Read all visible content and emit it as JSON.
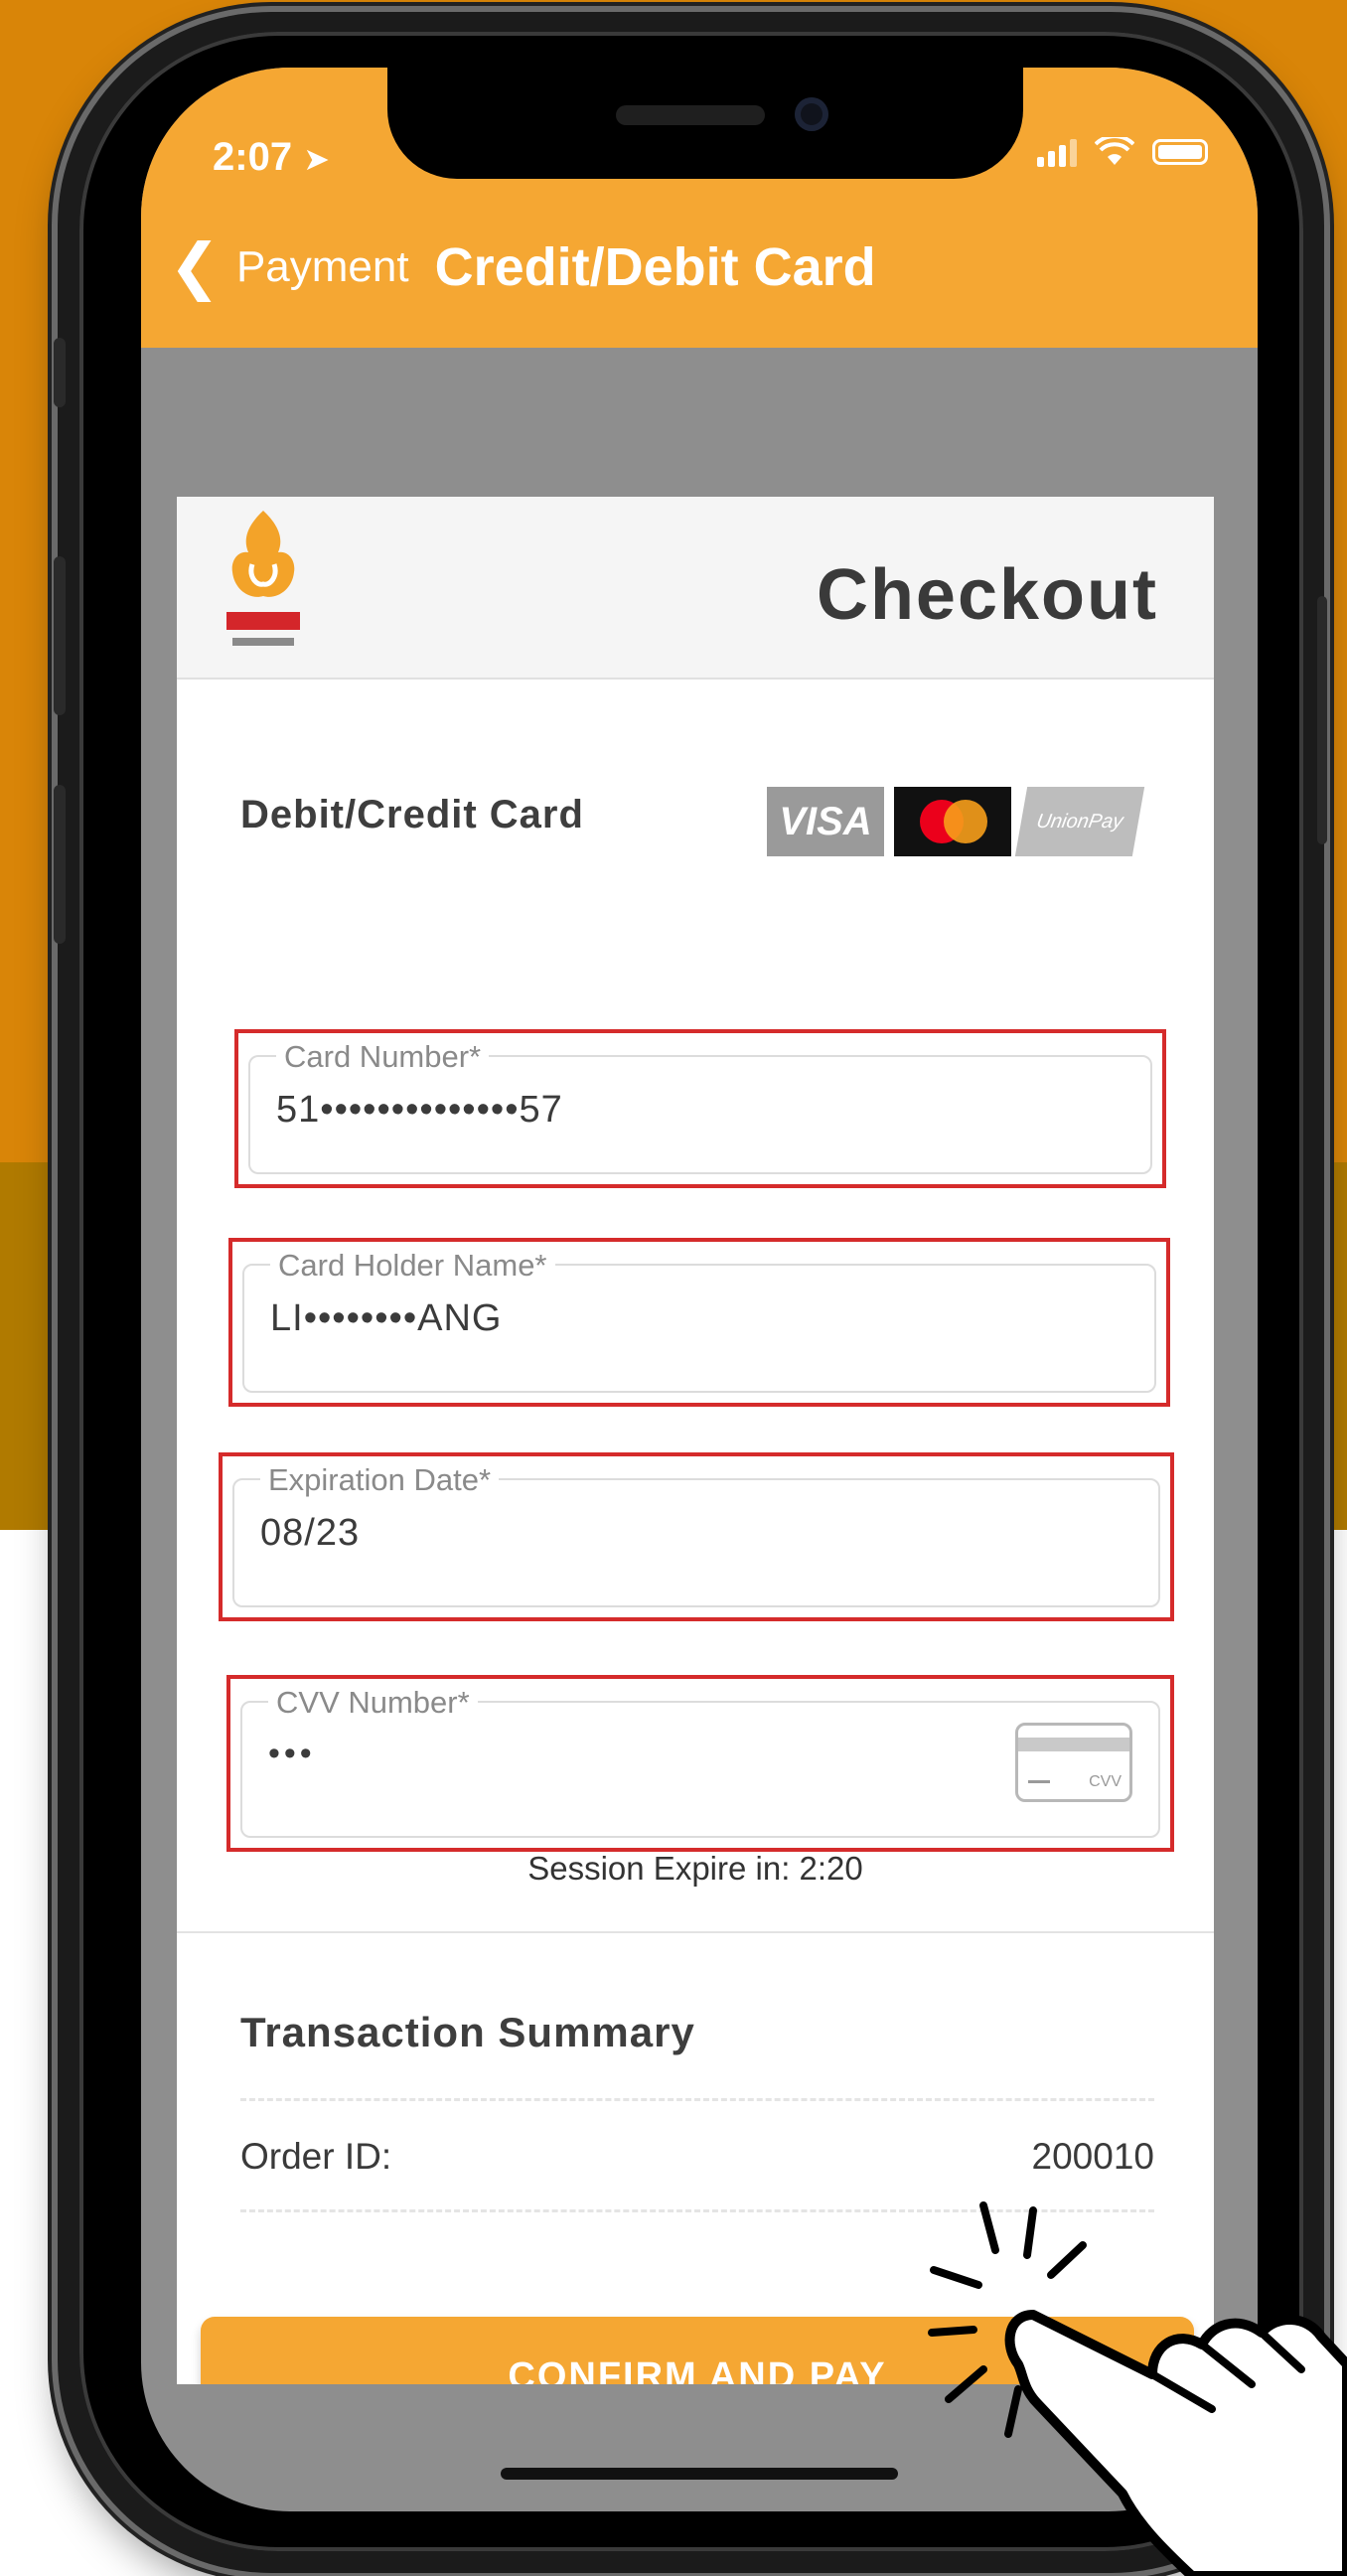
{
  "status_bar": {
    "time": "2:07"
  },
  "nav": {
    "back_label": "Payment",
    "title": "Credit/Debit Card"
  },
  "checkout": {
    "title": "Checkout",
    "section_label": "Debit/Credit Card",
    "card_brands": [
      "VISA",
      "Mastercard",
      "UnionPay"
    ],
    "fields": {
      "card_number": {
        "label": "Card Number*",
        "value": "51••••••••••••••57"
      },
      "card_holder": {
        "label": "Card Holder Name*",
        "value": "LI••••••••ANG"
      },
      "expiration": {
        "label": "Expiration Date*",
        "value": "08/23"
      },
      "cvv": {
        "label": "CVV Number*",
        "value": "•••",
        "icon_text": "CVV"
      }
    },
    "session": "Session Expire in: 2:20",
    "summary": {
      "title": "Transaction Summary",
      "order_id_label": "Order ID:",
      "order_id_value": "200010"
    },
    "pay_button": "CONFIRM AND PAY"
  },
  "colors": {
    "header_orange": "#f5a733",
    "background_orange": "#d98508",
    "highlight_red": "#d52b2b"
  }
}
